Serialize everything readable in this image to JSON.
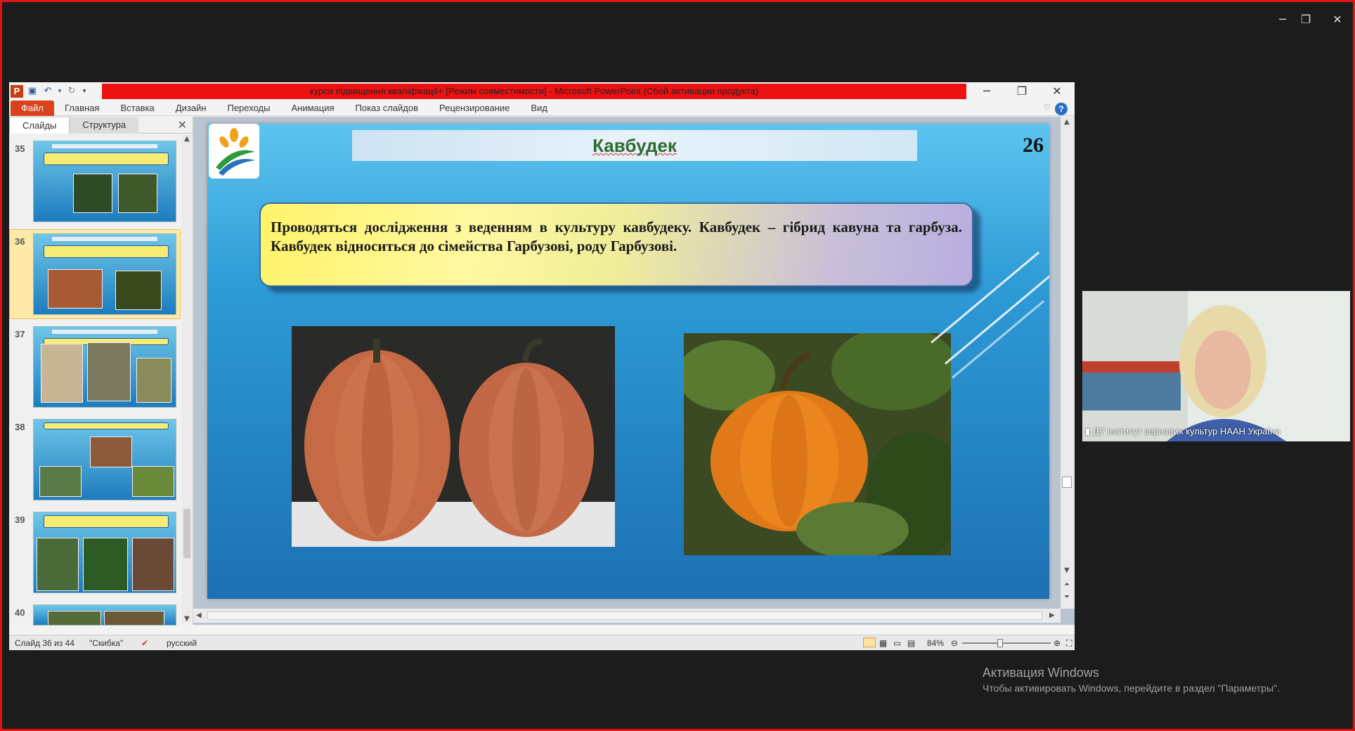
{
  "window": {
    "title": "курси підвищення кваліфікації+ [Режим совместимости]  -  Microsoft PowerPoint (Сбой активации продукта)",
    "controls": {
      "minimize": "─",
      "restore": "❐",
      "close": "✕"
    }
  },
  "ribbon": {
    "tabs": [
      "Файл",
      "Главная",
      "Вставка",
      "Дизайн",
      "Переходы",
      "Анимация",
      "Показ слайдов",
      "Рецензирование",
      "Вид"
    ],
    "help": "?"
  },
  "panel": {
    "tabs": [
      "Слайды",
      "Структура"
    ],
    "close": "✕",
    "slides": [
      {
        "num": "35",
        "selected": false
      },
      {
        "num": "36",
        "selected": true
      },
      {
        "num": "37",
        "selected": false
      },
      {
        "num": "38",
        "selected": false
      },
      {
        "num": "39",
        "selected": false
      },
      {
        "num": "40",
        "selected": false
      }
    ]
  },
  "slide": {
    "title": "Кавбудек",
    "number": "26",
    "body": "Проводяться дослідження з веденням в культуру кавбудеку. Кавбудек – гібрид кавуна та гарбуза. Кавбудек відноситься до сімейства Гарбузові,  роду Гарбузові."
  },
  "status": {
    "slide_info": "Слайд 36 из 44",
    "theme": "\"Скибка\"",
    "language": "русский",
    "zoom": "84%"
  },
  "webcam": {
    "label": "ДУ Інститут зернових культур НААН України"
  },
  "activation": {
    "line1": "Активация Windows",
    "line2": "Чтобы активировать Windows, перейдите в раздел \"Параметры\"."
  },
  "colors": {
    "title_bar_accent": "#ee1111",
    "file_tab": "#d9421d",
    "frame_border": "#e01515"
  }
}
